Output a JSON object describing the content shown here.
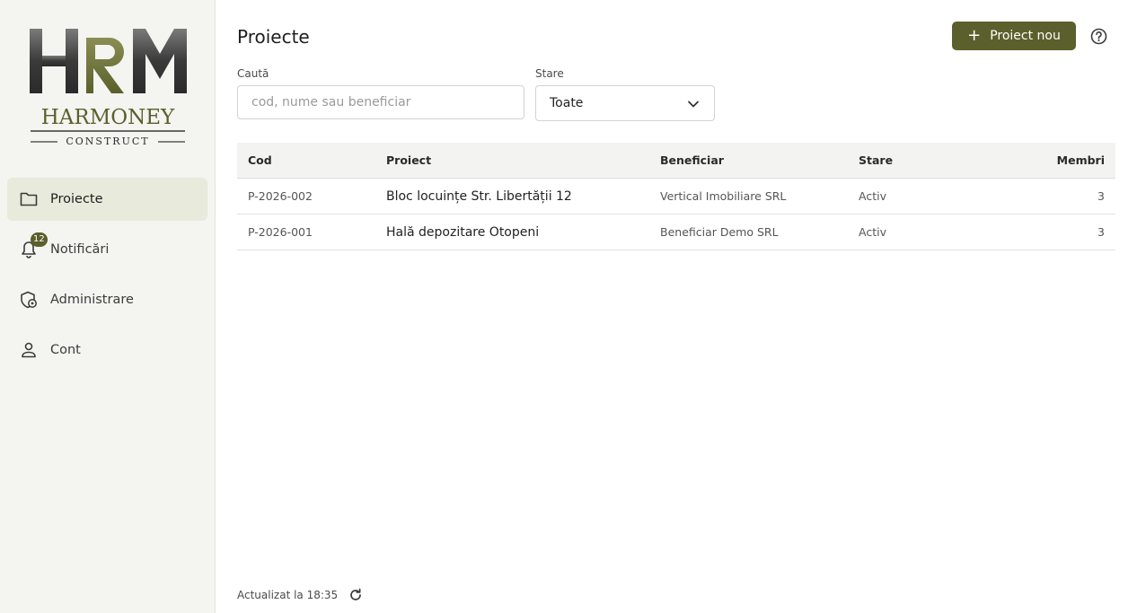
{
  "brand": {
    "logo_letters": "HRM",
    "logo_name": "HARMONEY",
    "logo_sub": "CONSTRUCT",
    "accent": "#5b5f2b",
    "active_bg": "#e8eadb"
  },
  "sidebar": {
    "items": [
      {
        "label": "Proiecte",
        "icon": "folder-icon",
        "active": true
      },
      {
        "label": "Notificări",
        "icon": "bell-icon",
        "badge": "12"
      },
      {
        "label": "Administrare",
        "icon": "shield-gear-icon"
      },
      {
        "label": "Cont",
        "icon": "person-icon"
      }
    ]
  },
  "header": {
    "title": "Proiecte",
    "new_button": "Proiect nou",
    "help_icon": "help-icon"
  },
  "filters": {
    "search_label": "Caută",
    "search_placeholder": "cod, nume sau beneficiar",
    "search_value": "",
    "status_label": "Stare",
    "status_value": "Toate"
  },
  "table": {
    "columns": [
      "Cod",
      "Proiect",
      "Beneficiar",
      "Stare",
      "Membri"
    ],
    "rows": [
      {
        "code": "P-2026-002",
        "name": "Bloc locuințe Str. Libertății 12",
        "beneficiary": "Vertical Imobiliare SRL",
        "status": "Activ",
        "members": "3"
      },
      {
        "code": "P-2026-001",
        "name": "Hală depozitare Otopeni",
        "beneficiary": "Beneficiar Demo SRL",
        "status": "Activ",
        "members": "3"
      }
    ]
  },
  "footer": {
    "updated": "Actualizat la 18:35"
  }
}
